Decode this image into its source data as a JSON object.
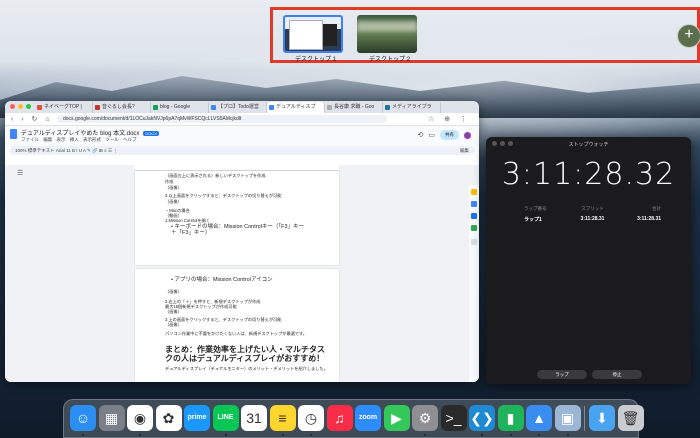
{
  "spaces": {
    "desktops": [
      {
        "label": "デスクトップ 1"
      },
      {
        "label": "デスクトップ 2"
      }
    ],
    "add_symbol": "+"
  },
  "chrome": {
    "tabs": [
      {
        "label": "ネイベーグTOP |"
      },
      {
        "label": "音ぐるし会長?"
      },
      {
        "label": "blog - Google"
      },
      {
        "label": "【プロ】Todo運営"
      },
      {
        "label": "デュアルディスプ"
      },
      {
        "label": "長谷康 求職 - Goo"
      },
      {
        "label": "メディアライブラ"
      }
    ],
    "url": "docs.google.com/document/d/1LOCuJakNVJp6pA7qMvWFSCQcLLVS5AMcjkdlt",
    "doc_title": "デュアルディスプレイやめた blog 本文.docx",
    "doc_badge": "DOCX",
    "doc_menus": "ファイル 編集 表示 挿入 表示形式 ツール ヘルプ",
    "toolbar_text": "100% 標準テキスト Arial 11 B I U A ✎ 🔗 ⊞ ≡ ☰ ⋮",
    "share_label": "共有",
    "edit_label": "編集",
    "page1_lines": [
      "（画面左上に表示される）新しいデスクトップを作成",
      "作成",
      "（画像）",
      "3.以上画面をクリックすると、デスクトップの切り替えが可能",
      "（画像）",
      "・Macの場合",
      "（動画）",
      "1.Mission Controlを開く"
    ],
    "page1_bullet": "キーボードの場合：Mission Controlキー（「F3」キー＋「F3」キー）",
    "page2_bullet": "アプリの場合：Mission Controlアイコン",
    "page2_lines": [
      "（画像）",
      "2.右上の「＋」を押すと、新規デスクトップが作成",
      "最大16個新規デスクトップが作成可能",
      "（画像）",
      "3.上の画面をクリックすると、デスクトップの切り替えが可能",
      "（画像）",
      "パソコン作業中に不要をかけたくない人は、新規デスクトップが最適です。"
    ],
    "heading": "まとめ：作業効率を上げたい人・マルチタスクの人はデュアルディスプレイがおすすめ！",
    "footer_line": "デュアルディスプレイ（デュアルモニター）のメリット・デメリットを紹介しました。"
  },
  "stopwatch": {
    "title": "ストップウォッチ",
    "time": "3:11:28.32",
    "lap_headers": [
      "ラップ番号",
      "スプリット",
      "合計"
    ],
    "laps": [
      {
        "name": "ラップ1",
        "split": "3:11:28.31",
        "total": "3:11:28.31"
      }
    ],
    "lap_button": "ラップ",
    "stop_button": "停止"
  },
  "dock": {
    "apps": [
      {
        "name": "finder",
        "glyph": "☺",
        "color": "#2b8ef0"
      },
      {
        "name": "launchpad",
        "glyph": "▦",
        "color": "#7a7f88"
      },
      {
        "name": "chrome",
        "glyph": "◉",
        "color": "#ffffff"
      },
      {
        "name": "photos",
        "glyph": "✿",
        "color": "#ffffff"
      },
      {
        "name": "prime-video",
        "glyph": "prime",
        "color": "#1a98ff"
      },
      {
        "name": "line",
        "glyph": "LINE",
        "color": "#06c755"
      },
      {
        "name": "calendar",
        "glyph": "31",
        "color": "#ffffff"
      },
      {
        "name": "notes",
        "glyph": "≡",
        "color": "#ffd52e"
      },
      {
        "name": "clock",
        "glyph": "◷",
        "color": "#ffffff"
      },
      {
        "name": "music",
        "glyph": "♫",
        "color": "#fa2d48"
      },
      {
        "name": "zoom",
        "glyph": "zoom",
        "color": "#2d8cff"
      },
      {
        "name": "facetime",
        "glyph": "▶",
        "color": "#34c759"
      },
      {
        "name": "system-settings",
        "glyph": "⚙",
        "color": "#8e8e93"
      },
      {
        "name": "terminal",
        "glyph": ">_",
        "color": "#2a2a2a"
      },
      {
        "name": "vscode",
        "glyph": "❮❯",
        "color": "#1f8ad2"
      },
      {
        "name": "numbers",
        "glyph": "▮",
        "color": "#1fb35b"
      },
      {
        "name": "keynote",
        "glyph": "▲",
        "color": "#3b8cf1"
      },
      {
        "name": "preview",
        "glyph": "▣",
        "color": "#9cb7d6"
      },
      {
        "name": "downloads",
        "glyph": "⬇",
        "color": "#4aa3f0"
      },
      {
        "name": "trash",
        "glyph": "🗑",
        "color": "#c9ccd1"
      }
    ]
  }
}
